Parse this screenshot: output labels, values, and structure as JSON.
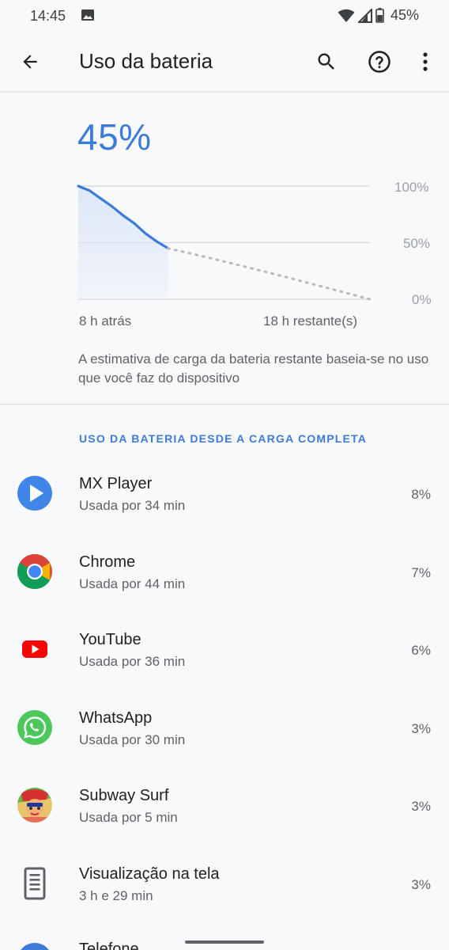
{
  "status_bar": {
    "time": "14:45",
    "battery": "45%"
  },
  "app_bar": {
    "title": "Uso da bateria"
  },
  "battery": {
    "percent_text": "45%",
    "estimate_text": "A estimativa de carga da bateria restante baseia-se no uso que você faz do dispositivo"
  },
  "chart_data": {
    "type": "line",
    "y_ticks": [
      "100%",
      "50%",
      "0%"
    ],
    "x_left_label": "8 h atrás",
    "x_right_label": "18 h restante(s)",
    "ylim": [
      0,
      100
    ],
    "series": [
      {
        "x": [
          0,
          1,
          2,
          3,
          4,
          5,
          6,
          7,
          8
        ],
        "values": [
          100,
          96,
          89,
          82,
          74,
          67,
          58,
          51,
          45
        ]
      },
      {
        "x": [
          8,
          26
        ],
        "values": [
          45,
          0
        ],
        "style": "dotted"
      }
    ],
    "xlim": [
      0,
      26
    ],
    "grid": true,
    "colors": {
      "line": "#3d7bd8",
      "fill": "#dde7f8",
      "projection": "#b7bbc0"
    }
  },
  "section": {
    "header": "USO DA BATERIA DESDE A CARGA COMPLETA"
  },
  "apps": [
    {
      "name": "MX Player",
      "usage": "Usada por 34 min",
      "percent": "8%",
      "icon": "mx-player-icon"
    },
    {
      "name": "Chrome",
      "usage": "Usada por 44 min",
      "percent": "7%",
      "icon": "chrome-icon"
    },
    {
      "name": "YouTube",
      "usage": "Usada por 36 min",
      "percent": "6%",
      "icon": "youtube-icon"
    },
    {
      "name": "WhatsApp",
      "usage": "Usada por 30 min",
      "percent": "3%",
      "icon": "whatsapp-icon"
    },
    {
      "name": "Subway Surf",
      "usage": "Usada por 5 min",
      "percent": "3%",
      "icon": "subway-surf-icon"
    },
    {
      "name": "Visualização na tela",
      "usage": "3 h e 29 min",
      "percent": "3%",
      "icon": "screen-icon"
    }
  ],
  "partial_app": {
    "name": "Telefone"
  }
}
